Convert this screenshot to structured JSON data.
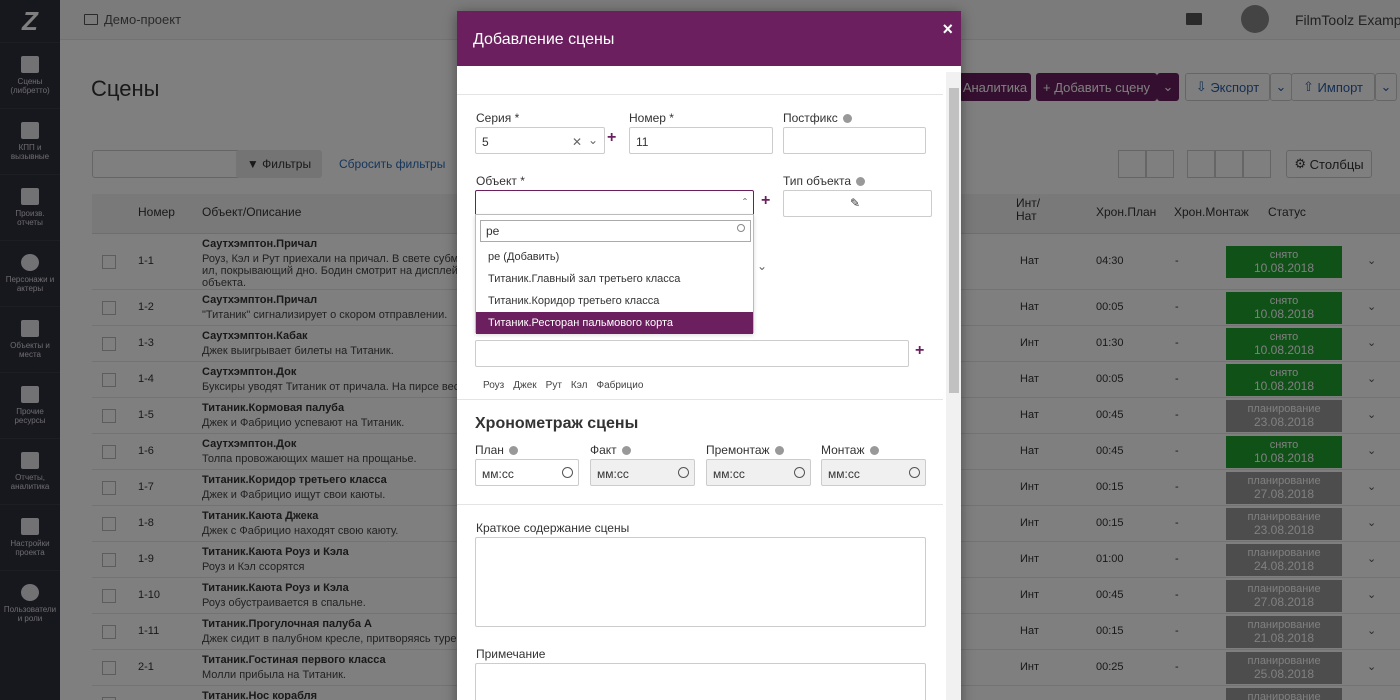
{
  "topbar": {
    "project": "Демо-проект",
    "user": "FilmToolz Example"
  },
  "sidebar": {
    "logo": "Z",
    "items": [
      "Сцены (либретто)",
      "КПП и вызывные",
      "Произв. отчеты",
      "Персонажи и актеры",
      "Объекты и места",
      "Прочие ресурсы",
      "Отчеты, аналитика",
      "Настройки проекта",
      "Пользователи и роли"
    ]
  },
  "page": {
    "title": "Сцены",
    "analytics": "Аналитика",
    "add_scene": "Добавить сцену",
    "export": "Экспорт",
    "import": "Импорт",
    "filters": "Фильтры",
    "reset_filters": "Сбросить фильтры",
    "columns": "Столбцы"
  },
  "table": {
    "headers": {
      "num": "Номер",
      "obj": "Объект/Описание",
      "int_nat": "Инт/ Нат",
      "chron_plan": "Хрон.План",
      "chron_mont": "Хрон.Монтаж",
      "status": "Статус"
    },
    "rows": [
      {
        "num": "1-1",
        "title": "Саутхэмптон.Причал",
        "desc": "Роуз, Кэл и Рут приехали на причал. В свете субм",
        "desc2": "ил, покрывающий дно. Бодин смотрит на дисплей",
        "desc3": "объекта.",
        "int": "Нат",
        "plan": "04:30",
        "mont": "-",
        "status": "снято",
        "date": "10.08.2018",
        "sc": "done"
      },
      {
        "num": "1-2",
        "title": "Саутхэмптон.Причал",
        "desc": "\"Титаник\" сигнализирует о скором отправлении.",
        "int": "Нат",
        "plan": "00:05",
        "mont": "-",
        "status": "снято",
        "date": "10.08.2018",
        "sc": "done"
      },
      {
        "num": "1-3",
        "title": "Саутхэмптон.Кабак",
        "desc": "Джек выигрывает билеты на Титаник.",
        "int": "Инт",
        "plan": "01:30",
        "mont": "-",
        "status": "снято",
        "date": "10.08.2018",
        "sc": "done"
      },
      {
        "num": "1-4",
        "title": "Саутхэмптон.Док",
        "desc": "Буксиры уводят Титаник от причала. На пирсе вес",
        "int": "Нат",
        "plan": "00:05",
        "mont": "-",
        "status": "снято",
        "date": "10.08.2018",
        "sc": "done"
      },
      {
        "num": "1-5",
        "title": "Титаник.Кормовая палуба",
        "desc": "Джек и Фабрицио успевают на Титаник.",
        "int": "Нат",
        "plan": "00:45",
        "mont": "-",
        "status": "планирование",
        "date": "23.08.2018",
        "sc": "plan"
      },
      {
        "num": "1-6",
        "title": "Саутхэмптон.Док",
        "desc": "Толпа провожающих машет на прощанье.",
        "int": "Нат",
        "plan": "00:45",
        "mont": "-",
        "status": "снято",
        "date": "10.08.2018",
        "sc": "done"
      },
      {
        "num": "1-7",
        "title": "Титаник.Коридор третьего класса",
        "desc": "Джек и Фабрицио ищут свои каюты.",
        "int": "Инт",
        "plan": "00:15",
        "mont": "-",
        "status": "планирование",
        "date": "27.08.2018",
        "sc": "plan"
      },
      {
        "num": "1-8",
        "title": "Титаник.Каюта Джека",
        "desc": "Джек с Фабрицио находят свою каюту.",
        "int": "Инт",
        "plan": "00:15",
        "mont": "-",
        "status": "планирование",
        "date": "23.08.2018",
        "sc": "plan"
      },
      {
        "num": "1-9",
        "title": "Титаник.Каюта Роуз и Кэла",
        "desc": "Роуз и Кэл ссорятся",
        "int": "Инт",
        "plan": "01:00",
        "mont": "-",
        "status": "планирование",
        "date": "24.08.2018",
        "sc": "plan"
      },
      {
        "num": "1-10",
        "title": "Титаник.Каюта Роуз и Кэла",
        "desc": "Роуз обустраивается в спальне.",
        "int": "Инт",
        "plan": "00:45",
        "mont": "-",
        "status": "планирование",
        "date": "27.08.2018",
        "sc": "plan"
      },
      {
        "num": "1-11",
        "title": "Титаник.Прогулочная палуба А",
        "desc": "Джек сидит в палубном кресле, притворяясь туре",
        "int": "Нат",
        "plan": "00:15",
        "mont": "-",
        "status": "планирование",
        "date": "21.08.2018",
        "sc": "plan"
      },
      {
        "num": "2-1",
        "title": "Титаник.Гостиная первого класса",
        "desc": "Молли прибыла на Титаник.",
        "int": "Инт",
        "plan": "00:25",
        "mont": "-",
        "status": "планирование",
        "date": "25.08.2018",
        "sc": "plan"
      },
      {
        "num": "",
        "title": "Титаник.Нос корабля",
        "desc": "",
        "int": "",
        "plan": "",
        "mont": "",
        "status": "планирование",
        "date": "",
        "sc": "plan"
      }
    ]
  },
  "modal": {
    "title": "Добавление сцены",
    "close": "×",
    "series_label": "Серия",
    "series_value": "5",
    "number_label": "Номер",
    "number_value": "11",
    "postfix_label": "Постфикс",
    "object_label": "Объект",
    "object_type_label": "Тип объекта",
    "required": "*",
    "dropdown": {
      "query": "ре",
      "options": [
        "ре (Добавить)",
        "Титаник.Главный зал третьего класса",
        "Титаник.Коридор третьего класса",
        "Титаник.Ресторан пальмового корта"
      ],
      "highlighted": 3
    },
    "characters": [
      "Роуз",
      "Джек",
      "Рут",
      "Кэл",
      "Фабрицио"
    ],
    "timing_title": "Хронометраж сцены",
    "timing": [
      {
        "label": "План",
        "placeholder": "мм:сс"
      },
      {
        "label": "Факт",
        "placeholder": "мм:сс"
      },
      {
        "label": "Премонтаж",
        "placeholder": "мм:сс"
      },
      {
        "label": "Монтаж",
        "placeholder": "мм:сс"
      }
    ],
    "summary_label": "Краткое содержание сцены",
    "note_label": "Примечание"
  },
  "colors": {
    "brand": "#6b1f5e",
    "done": "#1fa32f",
    "plan": "#9a9a9a",
    "sidebar": "#2f2f3c",
    "arrow": "#e0201e"
  }
}
